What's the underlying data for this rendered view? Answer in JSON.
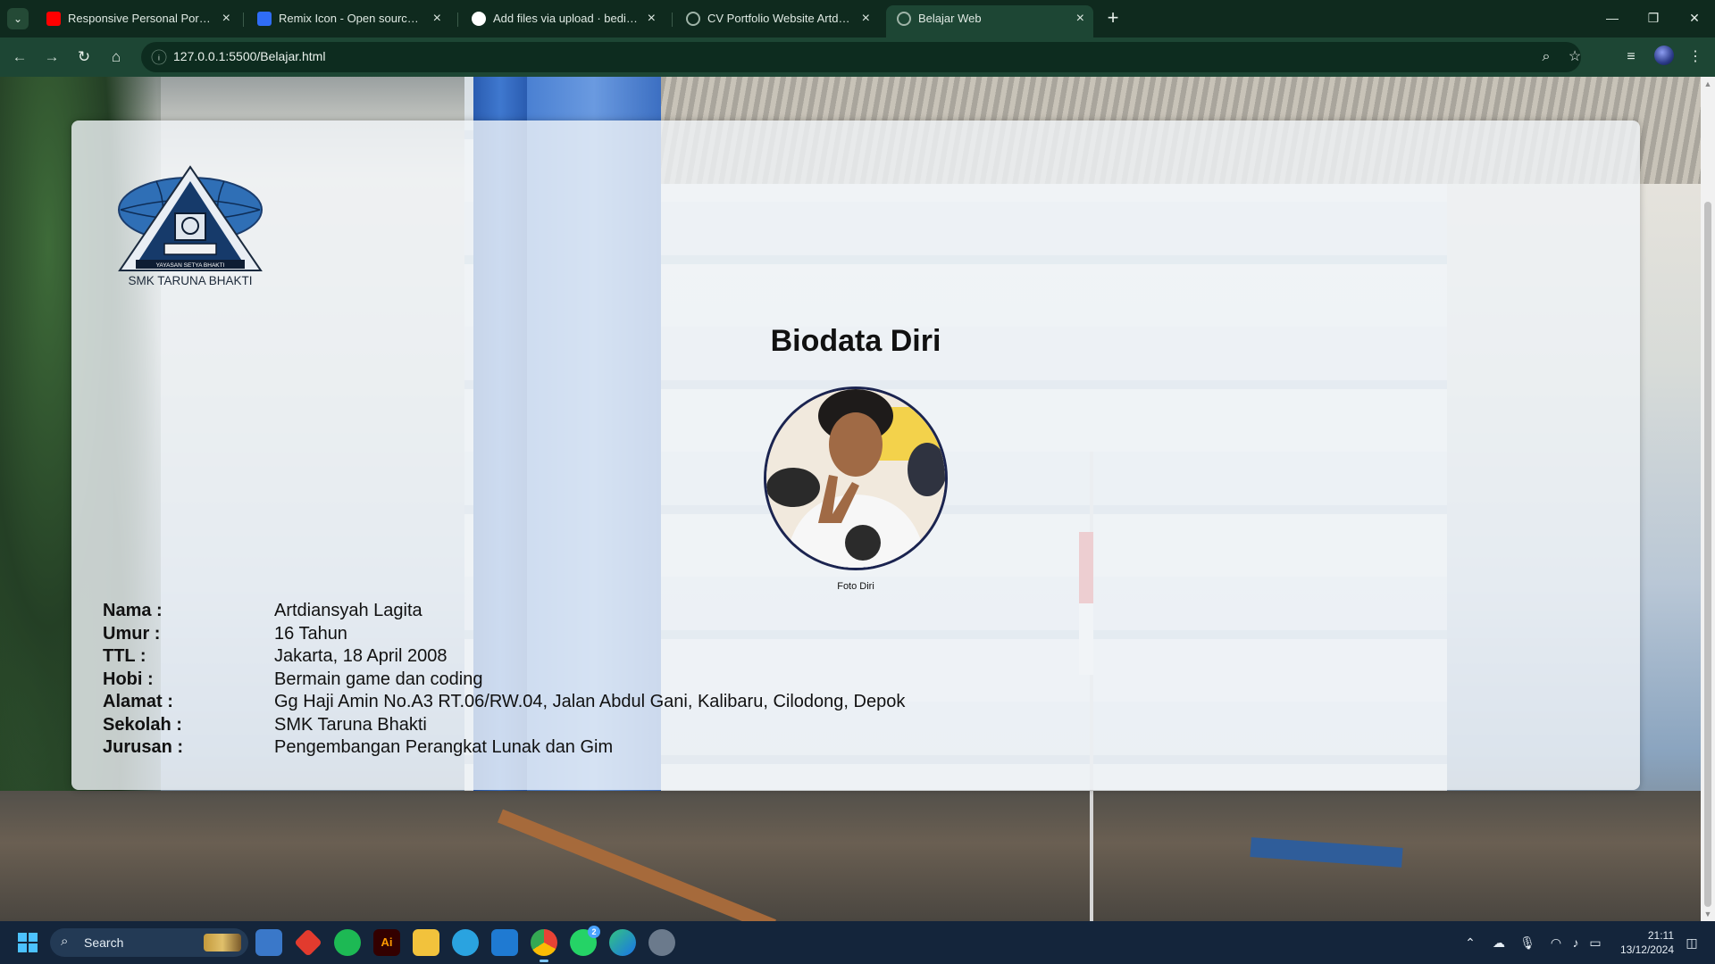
{
  "browser": {
    "tabs": [
      {
        "title": "Responsive Personal Portfolio W",
        "favicon_color": "#ff0000",
        "favicon": "youtube-icon"
      },
      {
        "title": "Remix Icon - Open source icon",
        "favicon_color": "#2f6df6",
        "favicon": "remix-icon"
      },
      {
        "title": "Add files via upload · bedimcod",
        "favicon_color": "#ffffff",
        "favicon": "github-icon"
      },
      {
        "title": "CV Portfolio Website Artdiansya",
        "favicon_color": "#9fb4a8",
        "favicon": "globe-icon"
      },
      {
        "title": "Belajar Web",
        "favicon_color": "#9fb4a8",
        "favicon": "globe-icon"
      }
    ],
    "active_tab": 4,
    "url": "127.0.0.1:5500/Belajar.html",
    "colors": {
      "tabbar": "#0f2a1e",
      "toolbar": "#1d4634"
    }
  },
  "page": {
    "logo_caption": "YAYASAN SETYA BHAKTI",
    "school_name": "SMK TARUNA BHAKTI",
    "title": "Biodata Diri",
    "photo_caption": "Foto Diri",
    "bio": [
      {
        "key": "Nama :",
        "value": "Artdiansyah Lagita"
      },
      {
        "key": "Umur :",
        "value": "16 Tahun"
      },
      {
        "key": "TTL :",
        "value": "Jakarta, 18 April 2008"
      },
      {
        "key": "Hobi :",
        "value": "Bermain game dan coding"
      },
      {
        "key": "Alamat :",
        "value": "Gg Haji Amin No.A3 RT.06/RW.04, Jalan Abdul Gani, Kalibaru, Cilodong, Depok"
      },
      {
        "key": "Sekolah :",
        "value": "SMK Taruna Bhakti"
      },
      {
        "key": "Jurusan :",
        "value": "Pengembangan Perangkat Lunak dan Gim"
      }
    ]
  },
  "taskbar": {
    "search_label": "Search",
    "apps": [
      "file-explorer-icon",
      "store-icon",
      "spotify-icon",
      "illustrator-icon",
      "folder-icon",
      "telegram-icon",
      "vscode-icon",
      "chrome-icon",
      "whatsapp-icon",
      "edge-icon",
      "settings-icon"
    ],
    "illustrator_label": "Ai",
    "whatsapp_badge": "2",
    "time": "21:11",
    "date": "13/12/2024"
  }
}
